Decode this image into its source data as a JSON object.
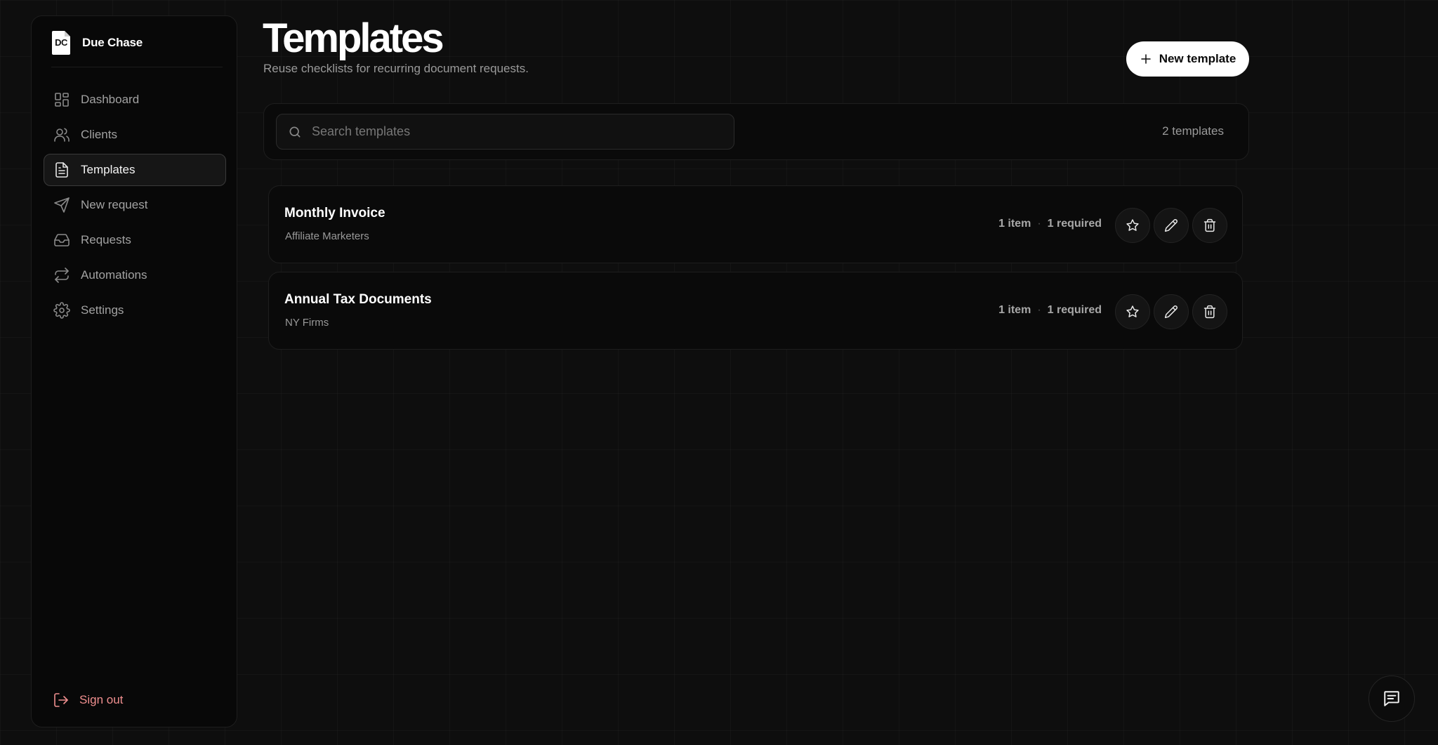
{
  "app": {
    "name": "Due Chase",
    "logo_text": "DC"
  },
  "sidebar": {
    "items": [
      {
        "label": "Dashboard",
        "icon": "dashboard-icon",
        "active": false
      },
      {
        "label": "Clients",
        "icon": "users-icon",
        "active": false
      },
      {
        "label": "Templates",
        "icon": "file-text-icon",
        "active": true
      },
      {
        "label": "New request",
        "icon": "send-icon",
        "active": false
      },
      {
        "label": "Requests",
        "icon": "inbox-icon",
        "active": false
      },
      {
        "label": "Automations",
        "icon": "repeat-icon",
        "active": false
      },
      {
        "label": "Settings",
        "icon": "gear-icon",
        "active": false
      }
    ],
    "signout_label": "Sign out"
  },
  "header": {
    "title": "Templates",
    "subtitle": "Reuse checklists for recurring document requests.",
    "new_button_label": "New template"
  },
  "search": {
    "placeholder": "Search templates",
    "value": "",
    "count_text": "2 templates"
  },
  "templates": [
    {
      "title": "Monthly Invoice",
      "subtitle": "Affiliate Marketers",
      "items_text": "1 item",
      "required_text": "1 required"
    },
    {
      "title": "Annual Tax Documents",
      "subtitle": "NY Firms",
      "items_text": "1 item",
      "required_text": "1 required"
    }
  ],
  "colors": {
    "background": "#0e0e0e",
    "panel": "#0a0a0a",
    "accent": "#ffffff",
    "danger": "#f08f8f"
  }
}
